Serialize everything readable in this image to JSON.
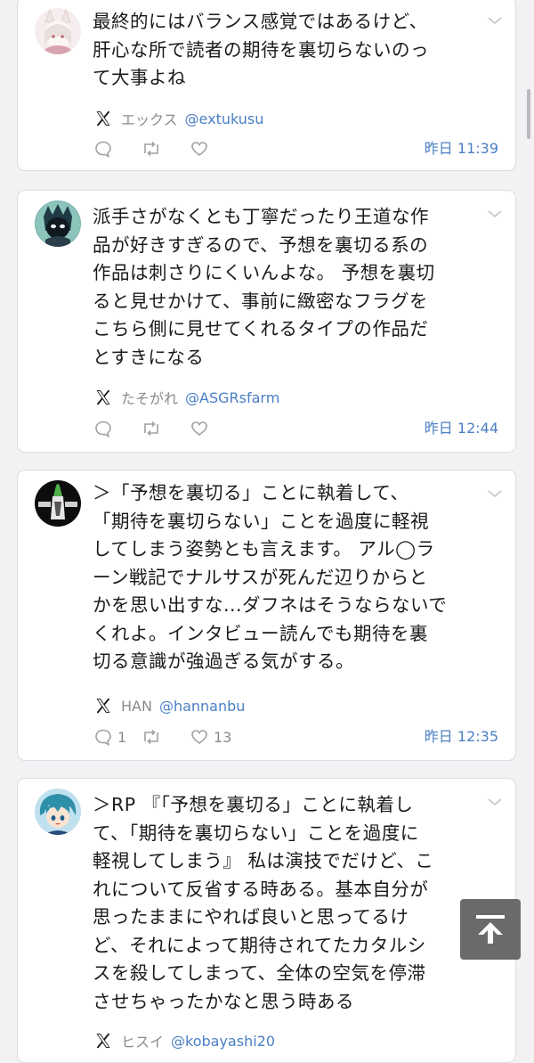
{
  "tweets": [
    {
      "text": "最終的にはバランス感覚ではあるけど、\n肝心な所で読者の期待を裏切らないのっ\nて大事よね",
      "author_name": "エックス",
      "author_handle": "@extukusu",
      "replies": "",
      "retweets": "",
      "likes": "",
      "time": "昨日 11:39"
    },
    {
      "text": "派手さがなくとも丁寧だったり王道な作\n品が好きすぎるので、予想を裏切る系の\n作品は刺さりにくいんよな。 予想を裏切\nると見せかけて、事前に緻密なフラグを\nこちら側に見せてくれるタイプの作品だ\nとすきになる",
      "author_name": "たそがれ",
      "author_handle": "@ASGRsfarm",
      "replies": "",
      "retweets": "",
      "likes": "",
      "time": "昨日 12:44"
    },
    {
      "text": "＞「予想を裏切る」ことに執着して、\n「期待を裏切らない」ことを過度に軽視\nしてしまう姿勢とも言えます。 アル◯ラ\nーン戦記でナルサスが死んだ辺りからと\nかを思い出すな...ダフネはそうならないで\nくれよ。インタビュー読んでも期待を裏\n切る意識が強過ぎる気がする。",
      "author_name": "HAN",
      "author_handle": "@hannanbu",
      "replies": "1",
      "retweets": "",
      "likes": "13",
      "time": "昨日 12:35"
    },
    {
      "text": "＞RP 『「予想を裏切る」ことに執着し\nて、「期待を裏切らない」ことを過度に\n軽視してしまう』 私は演技でだけど、こ\nれについて反省する時ある。基本自分が\n思ったままにやれば良いと思ってるけ\nど、それによって期待されてたカタルシ\nスを殺してしまって、全体の空気を停滞\nさせちゃったかなと思う時ある",
      "author_name": "ヒスイ",
      "author_handle": "@kobayashi20"
    }
  ],
  "colors": {
    "background": "#f2f2f4",
    "card": "#ffffff",
    "text": "#1a1a1a",
    "link": "#4a7fc4",
    "muted": "#8a8a8f"
  },
  "icons": {
    "platform_logo": "x-logo-icon",
    "reply": "reply-icon",
    "retweet": "retweet-icon",
    "like": "heart-icon",
    "menu": "chevron-down-icon",
    "back_to_top": "arrow-up-to-line-icon"
  }
}
